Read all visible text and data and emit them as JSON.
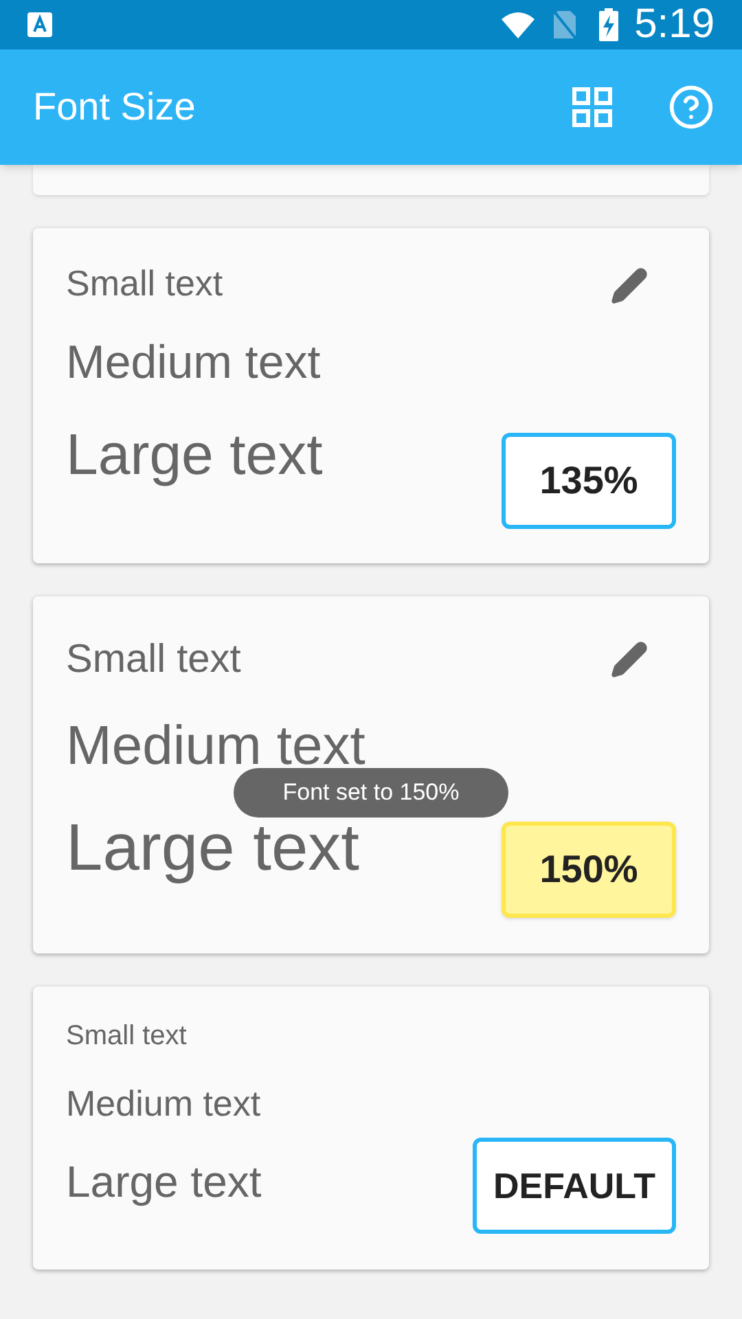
{
  "status_bar": {
    "time": "5:19"
  },
  "app_bar": {
    "title": "Font Size"
  },
  "cards": [
    {
      "small": "Small text",
      "medium": "Medium text",
      "large": "Large text",
      "editable": true,
      "button": {
        "label": "135%",
        "highlighted": false
      }
    },
    {
      "small": "Small text",
      "medium": "Medium text",
      "large": "Large text",
      "editable": true,
      "button": {
        "label": "150%",
        "highlighted": true
      }
    },
    {
      "small": "Small text",
      "medium": "Medium text",
      "large": "Large text",
      "editable": false,
      "button": {
        "label": "DEFAULT",
        "highlighted": false
      }
    }
  ],
  "toast": "Font set to 150%"
}
